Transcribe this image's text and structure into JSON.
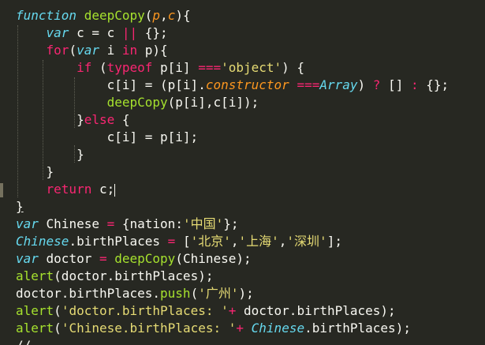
{
  "editor": {
    "lines": [
      {
        "t": [
          [
            "function",
            "kw"
          ],
          [
            " ",
            "txt"
          ],
          [
            "deepCopy",
            "fn"
          ],
          [
            "(",
            "txt"
          ],
          [
            "p",
            "arg"
          ],
          [
            ",",
            "txt"
          ],
          [
            "c",
            "arg"
          ],
          [
            "){",
            "txt"
          ]
        ]
      },
      {
        "t": [
          [
            "    ",
            "txt"
          ],
          [
            "var",
            "kw"
          ],
          [
            " c = c ",
            "txt"
          ],
          [
            "||",
            "kwp"
          ],
          [
            " {};",
            "txt"
          ]
        ]
      },
      {
        "t": [
          [
            "    ",
            "txt"
          ],
          [
            "for",
            "kwp"
          ],
          [
            "(",
            "txt"
          ],
          [
            "var",
            "kw"
          ],
          [
            " i ",
            "txt"
          ],
          [
            "in",
            "kwp"
          ],
          [
            " p){",
            "txt"
          ]
        ]
      },
      {
        "t": [
          [
            "        ",
            "txt"
          ],
          [
            "if",
            "kwp"
          ],
          [
            " (",
            "txt"
          ],
          [
            "typeof",
            "kwp"
          ],
          [
            " p[i] ",
            "txt"
          ],
          [
            "===",
            "kwp"
          ],
          [
            "'object'",
            "str"
          ],
          [
            ") {",
            "txt"
          ]
        ]
      },
      {
        "t": [
          [
            "            c[i] = (p[i].",
            "txt"
          ],
          [
            "constructor",
            "arg"
          ],
          [
            " ",
            "txt"
          ],
          [
            "===",
            "kwp"
          ],
          [
            "Array",
            "cls"
          ],
          [
            ") ",
            "txt"
          ],
          [
            "?",
            "kwp"
          ],
          [
            " [] ",
            "txt"
          ],
          [
            ":",
            "kwp"
          ],
          [
            " {};",
            "txt"
          ]
        ]
      },
      {
        "t": [
          [
            "            ",
            "txt"
          ],
          [
            "deepCopy",
            "fn"
          ],
          [
            "(p[i],c[i]);",
            "txt"
          ]
        ]
      },
      {
        "t": [
          [
            "        }",
            "txt"
          ],
          [
            "else",
            "kwp"
          ],
          [
            " {",
            "txt"
          ]
        ]
      },
      {
        "t": [
          [
            "            c[i] = p[i];",
            "txt"
          ]
        ]
      },
      {
        "t": [
          [
            "        }",
            "txt"
          ]
        ]
      },
      {
        "t": [
          [
            "    }",
            "txt"
          ]
        ]
      },
      {
        "t": [
          [
            "    ",
            "txt"
          ],
          [
            "return",
            "kwp"
          ],
          [
            " c;",
            "txt"
          ]
        ],
        "cursor": true
      },
      {
        "t": [
          [
            "}",
            "txt"
          ]
        ],
        "brace": true
      },
      {
        "t": [
          [
            "var",
            "kw"
          ],
          [
            " Chinese ",
            "txt"
          ],
          [
            "=",
            "kwp"
          ],
          [
            " {nation:",
            "txt"
          ],
          [
            "'中国'",
            "str"
          ],
          [
            "};",
            "txt"
          ]
        ]
      },
      {
        "t": [
          [
            "Chinese",
            "cls"
          ],
          [
            ".birthPlaces ",
            "txt"
          ],
          [
            "=",
            "kwp"
          ],
          [
            " [",
            "txt"
          ],
          [
            "'北京'",
            "str"
          ],
          [
            ",",
            "txt"
          ],
          [
            "'上海'",
            "str"
          ],
          [
            ",",
            "txt"
          ],
          [
            "'深圳'",
            "str"
          ],
          [
            "];",
            "txt"
          ]
        ]
      },
      {
        "t": [
          [
            "var",
            "kw"
          ],
          [
            " doctor ",
            "txt"
          ],
          [
            "=",
            "kwp"
          ],
          [
            " ",
            "txt"
          ],
          [
            "deepCopy",
            "fn"
          ],
          [
            "(Chinese);",
            "txt"
          ]
        ]
      },
      {
        "t": [
          [
            "alert",
            "fn"
          ],
          [
            "(doctor.birthPlaces);",
            "txt"
          ]
        ]
      },
      {
        "t": [
          [
            "doctor.birthPlaces.",
            "txt"
          ],
          [
            "push",
            "fn"
          ],
          [
            "(",
            "txt"
          ],
          [
            "'广州'",
            "str"
          ],
          [
            ");",
            "txt"
          ]
        ]
      },
      {
        "t": [
          [
            "alert",
            "fn"
          ],
          [
            "(",
            "txt"
          ],
          [
            "'doctor.birthPlaces: '",
            "str"
          ],
          [
            "+",
            "kwp"
          ],
          [
            " doctor.birthPlaces);",
            "txt"
          ]
        ]
      },
      {
        "t": [
          [
            "alert",
            "fn"
          ],
          [
            "(",
            "txt"
          ],
          [
            "'Chinese.birthPlaces: '",
            "str"
          ],
          [
            "+",
            "kwp"
          ],
          [
            " ",
            "txt"
          ],
          [
            "Chinese",
            "cls"
          ],
          [
            ".birthPlaces);",
            "txt"
          ]
        ]
      },
      {
        "t": [
          [
            "//",
            "txt"
          ]
        ],
        "partial": true
      }
    ]
  }
}
